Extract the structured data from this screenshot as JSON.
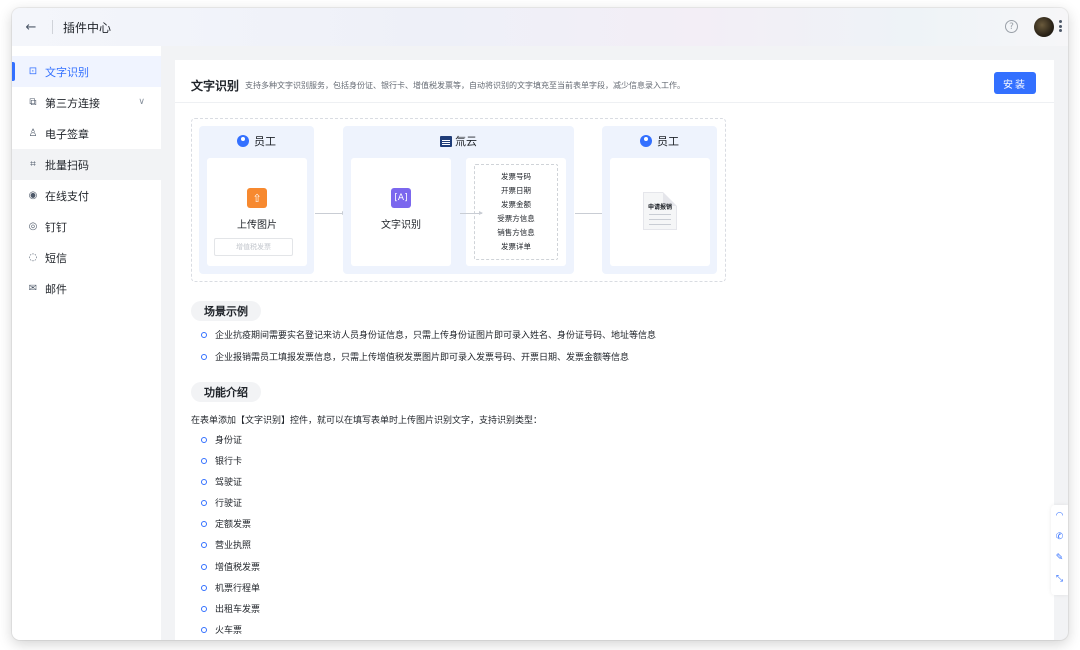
{
  "window": {
    "title": "插件中心"
  },
  "sidebar": {
    "items": [
      {
        "label": "文字识别",
        "icon": "ocr-icon",
        "glyph": "⊡"
      },
      {
        "label": "第三方连接",
        "icon": "link-icon",
        "glyph": "⧉"
      },
      {
        "label": "电子签章",
        "icon": "stamp-icon",
        "glyph": "♙"
      },
      {
        "label": "批量扫码",
        "icon": "scan-icon",
        "glyph": "⌗"
      },
      {
        "label": "在线支付",
        "icon": "payment-icon",
        "glyph": "◉"
      },
      {
        "label": "钉钉",
        "icon": "dingtalk-icon",
        "glyph": "◎"
      },
      {
        "label": "短信",
        "icon": "sms-icon",
        "glyph": "◌"
      },
      {
        "label": "邮件",
        "icon": "mail-icon",
        "glyph": "✉"
      }
    ]
  },
  "header": {
    "title": "文字识别",
    "description": "支持多种文字识别服务，包括身份证、银行卡、增值税发票等，自动将识别的文字填充至当前表单字段，减少信息录入工作。",
    "install_label": "安装"
  },
  "flow": {
    "left_head": "员工",
    "upload_label": "上传图片",
    "vat_placeholder": "增值税发票",
    "middle_head": "氚云",
    "ocr_label": "文字识别",
    "fields": [
      "发票号码",
      "开票日期",
      "发票金额",
      "受票方信息",
      "销售方信息",
      "发票详单"
    ],
    "right_head": "员工",
    "doc_title": "申请报销"
  },
  "scenes": {
    "title": "场景示例",
    "items": [
      "企业抗疫期间需要实名登记来访人员身份证信息，只需上传身份证图片即可录入姓名、身份证号码、地址等信息",
      "企业报销需员工填报发票信息，只需上传增值税发票图片即可录入发票号码、开票日期、发票金额等信息"
    ]
  },
  "features": {
    "title": "功能介绍",
    "intro": "在表单添加【文字识别】控件，就可以在填写表单时上传图片识别文字，支持识别类型：",
    "types": [
      "身份证",
      "银行卡",
      "驾驶证",
      "行驶证",
      "定额发票",
      "营业执照",
      "增值税发票",
      "机票行程单",
      "出租车发票",
      "火车票"
    ]
  },
  "colors": {
    "accent": "#3370ff",
    "upload": "#f7892f",
    "ocr": "#7b67ee"
  }
}
